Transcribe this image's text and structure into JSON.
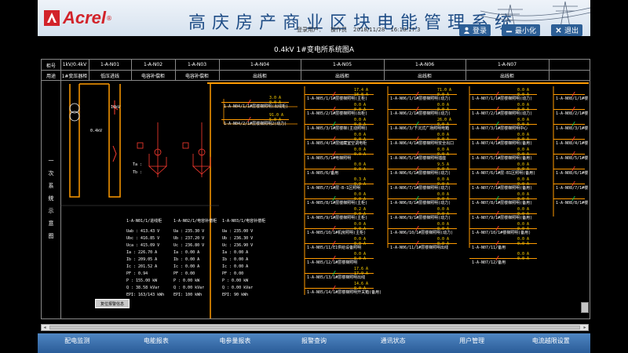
{
  "header": {
    "brand": "Acrel",
    "brand_reg": "®",
    "title": "高庆房产商业区块电能管理系统",
    "status": {
      "user_label": "登录用户：",
      "user": "操作员",
      "datetime": "2018/11/28　16:18:17.3"
    },
    "buttons": {
      "login": "登录",
      "minimize": "最小化",
      "exit": "退出"
    }
  },
  "diagram_title": "0.4kV 1#变电所系统图A",
  "table": {
    "row1_label": "柜号",
    "row2_label": "用途",
    "side_label_chars": [
      "一",
      "次",
      "系",
      "统",
      "示",
      "意",
      "图"
    ],
    "columns": [
      {
        "id": "1kV/0.4kV",
        "use": "1#变压器柜"
      },
      {
        "id": "1-A-N01",
        "use": "低压进线"
      },
      {
        "id": "1-A-N02",
        "use": "电容补偿柜"
      },
      {
        "id": "1-A-N03",
        "use": "电容补偿柜"
      },
      {
        "id": "1-A-N04",
        "use": "出线柜"
      },
      {
        "id": "1-A-N05",
        "use": "出线柜"
      },
      {
        "id": "1-A-N06",
        "use": "出线柜"
      },
      {
        "id": "1-A-N07",
        "use": "出线柜"
      }
    ]
  },
  "transformer": {
    "rating": "10kV",
    "low": "0.4kV",
    "temp_label": "Ta :",
    "temp_label2": "Tb :"
  },
  "meters": [
    {
      "title": "1-A-N01/1/进线柜",
      "lines": [
        "Uab : 413.43 V",
        "Ubc : 416.85 V",
        "Uca : 415.09 V",
        "Ia : 226.70 A",
        "Ib : 209.05 A",
        "Ic : 201.52 A",
        "PF : 0.94",
        "P : 155.00 kW",
        "Q : 38.58 kVar",
        "EPI: 163/143 kWh"
      ]
    },
    {
      "title": "1-A-N02/1/电容补偿柜",
      "lines": [
        "Ua : 235.30 V",
        "Ub : 237.20 V",
        "Uc : 236.80 V",
        "Ia : 0.00 A",
        "Ib : 0.00 A",
        "Ic : 0.00 A",
        "PF : 0.00",
        "P : 0.00 kW",
        "Q : 0.00 kVar",
        "EPI: 100 kWh"
      ]
    },
    {
      "title": "1-A-N03/1/电容补偿柜",
      "lines": [
        "Ua : 235.00 V",
        "Ub : 236.30 V",
        "Uc : 236.90 V",
        "Ia : 0.00 A",
        "Ib : 0.00 A",
        "Ic : 0.00 A",
        "PF : 0.00",
        "P : 0.00 kW",
        "Q : 0.00 kVar",
        "EPI: 90 kWh"
      ]
    }
  ],
  "reset_button": "复位报警信息",
  "feeders_n04": [
    {
      "name": "1-A-N04/1/1#层楼梯照明(出线柜)",
      "v1": "3.0 A",
      "v2": "0.0 A"
    },
    {
      "name": "1-A-N04/2/1#层楼梯照明2(动力)",
      "v1": "91.0 A",
      "v2": "5.0 A"
    }
  ],
  "feeders_n05": [
    {
      "name": "1-A-N05/1/1#层楼梯照明(主柜)",
      "v1": "17.4 A",
      "v2": "18.8 A"
    },
    {
      "name": "1-A-N05/2/1#层楼梯照明(出柜)",
      "v1": "0.0 A",
      "v2": "0.0 A"
    },
    {
      "name": "1-A-N05/3/1#层楼梯(主动照明)",
      "v1": "0.0 A",
      "v2": "0.0 A"
    },
    {
      "name": "1-A-N05/4/1#层储藏室空调电柜",
      "v1": "0.0 A",
      "v2": "0.0 A"
    },
    {
      "name": "1-A-N05/5/1#电梯照明",
      "v1": "0.0 A",
      "v2": "0.0 A"
    },
    {
      "name": "1-A-N05/6/备用",
      "v1": "0.0 A",
      "v2": "0.0 A"
    },
    {
      "name": "1-A-N05/7/1#层-B-1区照明",
      "v1": "0.3 A",
      "v2": "0.0 A"
    },
    {
      "name": "1-A-N05/8/1#层楼梯照明(主柜)",
      "v1": "0.0 A",
      "v2": "0.0 A"
    },
    {
      "name": "1-A-N05/9/1#层楼梯照明(主柜)",
      "v1": "0.2 A",
      "v2": "0.0 A"
    },
    {
      "name": "1-A-N05/10/1#机房照明(主柜)",
      "v1": "0.0 A",
      "v2": "0.0 A"
    },
    {
      "name": "1-A-N05/11/E1供给设备照明",
      "v1": "0.0 A",
      "v2": "0.0 A"
    },
    {
      "name": "1-A-N05/12/1#层楼梯照明",
      "v1": "0.0 A",
      "v2": "0.0 A"
    },
    {
      "name": "1-A-N05/13/1#层楼梯照明出线",
      "v1": "17.6 A",
      "v2": "17.9 A"
    },
    {
      "name": "1-A-N05/14/1#层楼梯照明开关箱(备用)",
      "v1": "14.6 A",
      "v2": "0.0 A"
    }
  ],
  "feeders_n06": [
    {
      "name": "1-A-N06/1/1#层楼梯照明(动力)",
      "v1": "71.0 A",
      "v2": "0.0 A"
    },
    {
      "name": "1-A-N06/2/1#层楼梯照明(动力)",
      "v1": "0.0 A",
      "v2": "0.0 A"
    },
    {
      "name": "1-A-N06/3/下沉式广场照明电箱",
      "v1": "26.0 A",
      "v2": "0.0 A"
    },
    {
      "name": "1-A-N06/4/1#层楼梯照明安全出口",
      "v1": "0.0 A",
      "v2": "0.0 A"
    },
    {
      "name": "1-A-N06/5/1#层楼梯照明插座",
      "v1": "0.0 A",
      "v2": "0.0 A"
    },
    {
      "name": "1-A-N06/6/1#层楼梯照明(动力)",
      "v1": "9.5 A",
      "v2": "0.0 A"
    },
    {
      "name": "1-A-N06/7/1#层楼梯照明(动力)",
      "v1": "0.0 A",
      "v2": "0.0 A"
    },
    {
      "name": "1-A-N06/8/1#层楼梯照明(动力)",
      "v1": "0.0 A",
      "v2": "0.0 A"
    },
    {
      "name": "1-A-N06/9/1#层楼梯照明(动力)",
      "v1": "0.0 A",
      "v2": "0.0 A"
    },
    {
      "name": "1-A-N06/10/1#层楼梯照明(动力)",
      "v1": "0.0 A",
      "v2": "0.0 A"
    },
    {
      "name": "1-A-N06/11/1#层楼梯照明出线",
      "v1": "0.0 A",
      "v2": "0.0 A"
    }
  ],
  "feeders_n07": [
    {
      "name": "1-A-N07/1/1#层楼梯照明(动力)",
      "v1": "0.0 A",
      "v2": "0.0 A"
    },
    {
      "name": "1-A-N07/2/1#层楼梯照明(动力)",
      "v1": "0.0 A",
      "v2": "0.0 A"
    },
    {
      "name": "1-A-N07/3/1#层楼梯照明中心",
      "v1": "0.0 A",
      "v2": "0.0 A"
    },
    {
      "name": "1-A-N07/4/1#层楼梯照明(备用)",
      "v1": "0.0 A",
      "v2": "0.0 A"
    },
    {
      "name": "1-A-N07/5/1#层楼梯照明(备用)",
      "v1": "0.0 A",
      "v2": "0.0 A"
    },
    {
      "name": "1-A-N07/6/1#层-B1区照明(备用)",
      "v1": "0.0 A",
      "v2": "0.0 A"
    },
    {
      "name": "1-A-N07/7/1#层楼梯照明(备用)",
      "v1": "0.0 A",
      "v2": "0.0 A"
    },
    {
      "name": "1-A-N07/8/1#层楼梯照明(备用)",
      "v1": "0.0 A",
      "v2": "0.0 A"
    },
    {
      "name": "1-A-N07/9/1#层楼梯照明(备用)",
      "v1": "0.0 A",
      "v2": "0.0 A"
    },
    {
      "name": "1-A-N07/10/1#楼梯照明(备用)",
      "v1": "0.0 A",
      "v2": "0.0 A"
    },
    {
      "name": "1-A-N07/11/备用",
      "v1": "0.0 A",
      "v2": "0.0 A"
    },
    {
      "name": "1-A-N07/12/备用",
      "v1": "0.0 A",
      "v2": "0.0 A"
    }
  ],
  "feeders_n08": [
    {
      "name": "1-A-N08/1/1#楼"
    },
    {
      "name": "1-A-N08/2/1#楼"
    },
    {
      "name": "1-A-N08/3/1#楼"
    },
    {
      "name": "1-A-N08/4/1#楼"
    },
    {
      "name": "1-A-N08/5/1#楼"
    },
    {
      "name": "1-A-N08/6/1#楼"
    },
    {
      "name": "1-A-N08/7/1#楼"
    },
    {
      "name": "1-A-N08/8/1#楼"
    }
  ],
  "nav": [
    "配电监测",
    "电能报表",
    "电参量报表",
    "报警查询",
    "通讯状态",
    "用户管理",
    "电流越限设置"
  ],
  "colors": {
    "busbar": "#ff9a00",
    "value_yellow": "#ffd200",
    "value_red": "#ff3b30",
    "breaker_closed": "#ff3b30",
    "breaker_open": "#00c853",
    "nav_bg": "#2a5c98"
  }
}
